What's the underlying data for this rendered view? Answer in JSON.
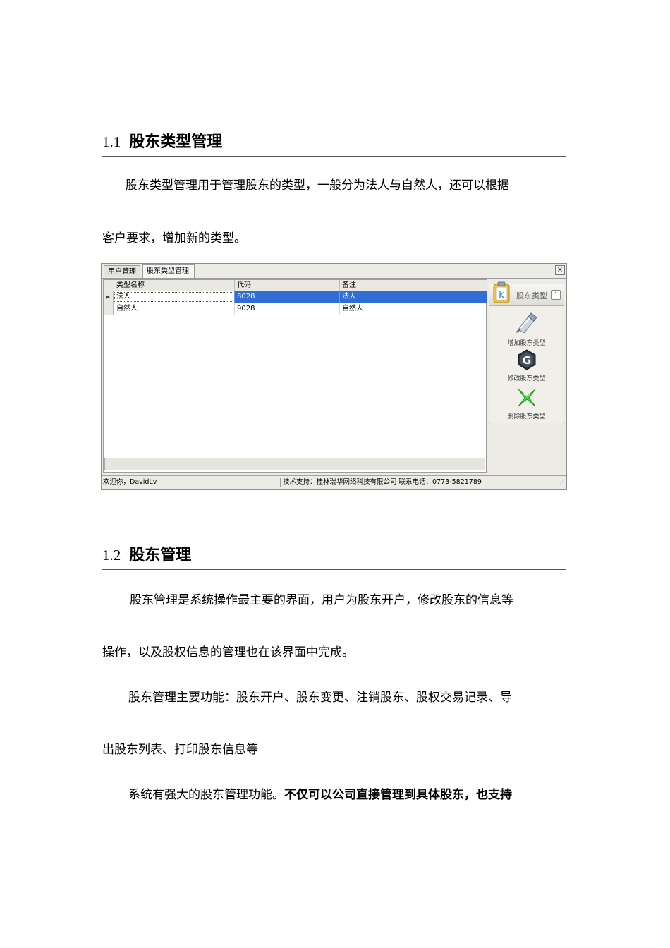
{
  "section1": {
    "number": "1.1",
    "title": "股东类型管理",
    "para_line1": "股东类型管理用于管理股东的类型，一般分为法人与自然人，还可以根据",
    "para_line2": "客户要求，增加新的类型。"
  },
  "app": {
    "tabs": [
      {
        "label": "用户管理"
      },
      {
        "label": "股东类型管理"
      }
    ],
    "close_glyph": "×",
    "grid": {
      "columns": [
        "类型名称",
        "代码",
        "备注"
      ],
      "rows": [
        {
          "name": "法人",
          "code": "8028",
          "note": "法人",
          "selected": true
        },
        {
          "name": "自然人",
          "code": "9028",
          "note": "自然人",
          "selected": false
        }
      ]
    },
    "panel": {
      "title": "股东类型",
      "toggle_glyph": "⌃",
      "actions": [
        {
          "label": "增加股东类型",
          "icon": "add-icon"
        },
        {
          "label": "修改股东类型",
          "icon": "edit-icon"
        },
        {
          "label": "删除股东类型",
          "icon": "delete-icon"
        }
      ]
    },
    "status": {
      "welcome": "欢迎你，DavidLv",
      "support": "技术支持：桂林瑞华网络科技有限公司 联系电话：0773-5821789"
    }
  },
  "section2": {
    "number": "1.2",
    "title": "股东管理",
    "p1_line1": "股东管理是系统操作最主要的界面，用户为股东开户，修改股东的信息等",
    "p1_line2": "操作，以及股权信息的管理也在该界面中完成。",
    "p2_line1": "股东管理主要功能：股东开户、股东变更、注销股东、股权交易记录、导",
    "p2_line2": "出股东列表、打印股东信息等",
    "p3_normal": "系统有强大的股东管理功能。",
    "p3_bold": "不仅可以公司直接管理到具体股东，也支持"
  }
}
